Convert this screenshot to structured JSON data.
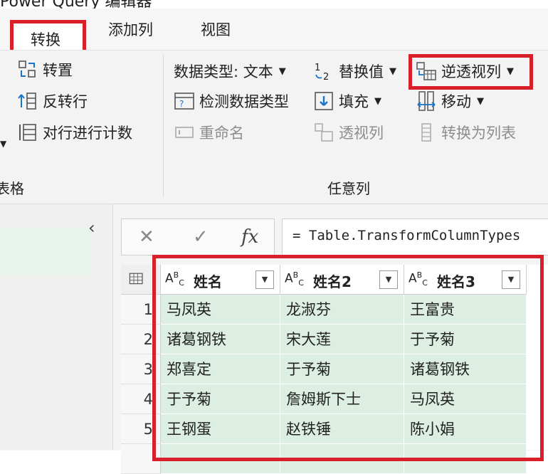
{
  "window": {
    "title_fragment": "Power Query 编辑器"
  },
  "tabs": [
    {
      "label": "转换",
      "active": true
    },
    {
      "label": "添加列"
    },
    {
      "label": "视图"
    }
  ],
  "ribbon": {
    "table_group": {
      "transpose": "转置",
      "reverse_rows": "反转行",
      "count_rows": "对行进行计数",
      "label": "表格"
    },
    "any_column_group": {
      "data_type": "数据类型: 文本",
      "detect_type": "检测数据类型",
      "rename": "重命名",
      "replace_values": "替换值",
      "fill": "填充",
      "pivot": "透视列",
      "unpivot": "逆透视列",
      "move": "移动",
      "convert_to_list": "转换为列表",
      "label": "任意列"
    }
  },
  "formula_bar": {
    "cancel": "✕",
    "commit": "✓",
    "fx": "fx",
    "formula": "= Table.TransformColumnTypes"
  },
  "grid": {
    "columns": [
      {
        "type": "ABC",
        "name": "姓名"
      },
      {
        "type": "ABC",
        "name": "姓名2"
      },
      {
        "type": "ABC",
        "name": "姓名3"
      }
    ],
    "rows": [
      {
        "n": "1",
        "c": [
          "马凤英",
          "龙淑芬",
          "王富贵"
        ]
      },
      {
        "n": "2",
        "c": [
          "诸葛钢铁",
          "宋大莲",
          "于予菊"
        ]
      },
      {
        "n": "3",
        "c": [
          "郑喜定",
          "于予菊",
          "诸葛钢铁"
        ]
      },
      {
        "n": "4",
        "c": [
          "于予菊",
          "詹姆斯下士",
          "马凤英"
        ]
      },
      {
        "n": "5",
        "c": [
          "王钢蛋",
          "赵铁锤",
          "陈小娟"
        ]
      }
    ]
  },
  "colors": {
    "highlight": "#d9202a",
    "cell_bg": "#dcefe2"
  }
}
